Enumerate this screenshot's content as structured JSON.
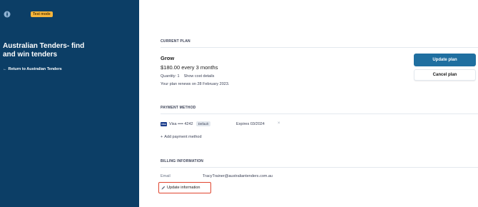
{
  "sidebar": {
    "test_badge": "Test mode",
    "title": "Australian Tenders- find and win tenders",
    "return_link": "Return to Australian Tenders"
  },
  "current_plan": {
    "section_label": "CURRENT PLAN",
    "name": "Grow",
    "price": "$180.00 every 3 months",
    "quantity": "Quantity: 1",
    "show_cost": "Show cost details",
    "renews": "Your plan renews on 28 February 2023.",
    "update_button": "Update plan",
    "cancel_button": "Cancel plan"
  },
  "payment_method": {
    "section_label": "PAYMENT METHOD",
    "card_brand_badge": "VISA",
    "card": "Visa •••• 4242",
    "default_badge": "Default",
    "expires": "Expires 03/2024",
    "add": "Add payment method"
  },
  "billing": {
    "section_label": "BILLING INFORMATION",
    "email_label": "Email",
    "email_value": "TracyTrainer@australiantenders.com.au",
    "update_link": "Update information"
  },
  "colors": {
    "sidebar_bg": "#0c3e66",
    "primary_button": "#1f6fa0",
    "highlight_border": "#e0452f",
    "test_badge": "#f6b53c"
  }
}
